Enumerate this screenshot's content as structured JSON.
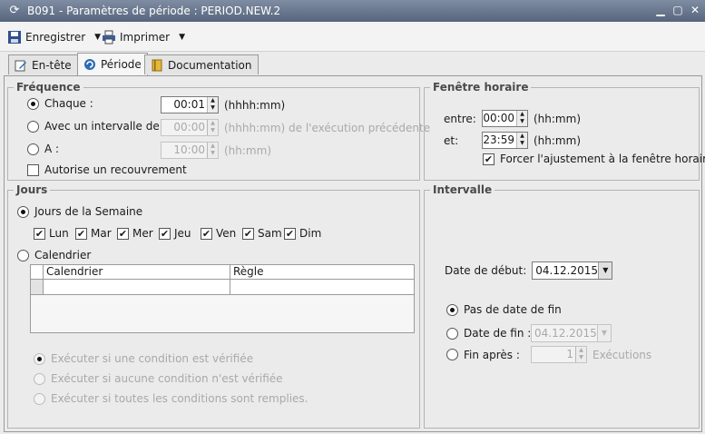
{
  "window": {
    "title": "B091 - Paramètres de période : PERIOD.NEW.2"
  },
  "toolbar": {
    "save_label": "Enregistrer",
    "print_label": "Imprimer"
  },
  "tabs": [
    {
      "label": "En-tête",
      "icon": "edit-icon",
      "active": false
    },
    {
      "label": "Période",
      "icon": "period-icon",
      "active": true
    },
    {
      "label": "Documentation",
      "icon": "book-icon",
      "active": false
    }
  ],
  "frequence": {
    "legend": "Fréquence",
    "chaque": {
      "label": "Chaque :",
      "value": "00:01",
      "unit": "(hhhh:mm)",
      "selected": true
    },
    "intervalle": {
      "label": "Avec un intervalle de :",
      "value": "00:00",
      "unit": "(hhhh:mm) de l'exécution précédente"
    },
    "a": {
      "label": "A :",
      "value": "10:00",
      "unit": "(hh:mm)"
    },
    "recouvrement": {
      "label": "Autorise un recouvrement",
      "checked": false
    }
  },
  "fenetre": {
    "legend": "Fenêtre horaire",
    "entre": {
      "label": "entre:",
      "value": "00:00",
      "unit": "(hh:mm)"
    },
    "et": {
      "label": "et:",
      "value": "23:59",
      "unit": "(hh:mm)"
    },
    "forcer": {
      "label": "Forcer l'ajustement à la fenêtre horaire",
      "checked": true
    }
  },
  "jours": {
    "legend": "Jours",
    "semaine": {
      "label": "Jours de la Semaine",
      "selected": true
    },
    "days": [
      "Lun",
      "Mar",
      "Mer",
      "Jeu",
      "Ven",
      "Sam",
      "Dim"
    ],
    "calendrier": {
      "label": "Calendrier",
      "selected": false
    },
    "table": {
      "columns": [
        "Calendrier",
        "Règle"
      ]
    },
    "conditions": [
      "Exécuter si une condition est vérifiée",
      "Exécuter si aucune condition n'est vérifiée",
      "Exécuter si toutes les conditions sont remplies."
    ]
  },
  "intervalle": {
    "legend": "Intervalle",
    "date_debut": {
      "label": "Date de début:",
      "value": "04.12.2015"
    },
    "pas_fin": {
      "label": "Pas de date de fin",
      "selected": true
    },
    "date_fin": {
      "label": "Date de fin :",
      "value": "04.12.2015"
    },
    "fin_apres": {
      "label": "Fin après :",
      "value": "1",
      "unit": "Exécutions"
    }
  }
}
